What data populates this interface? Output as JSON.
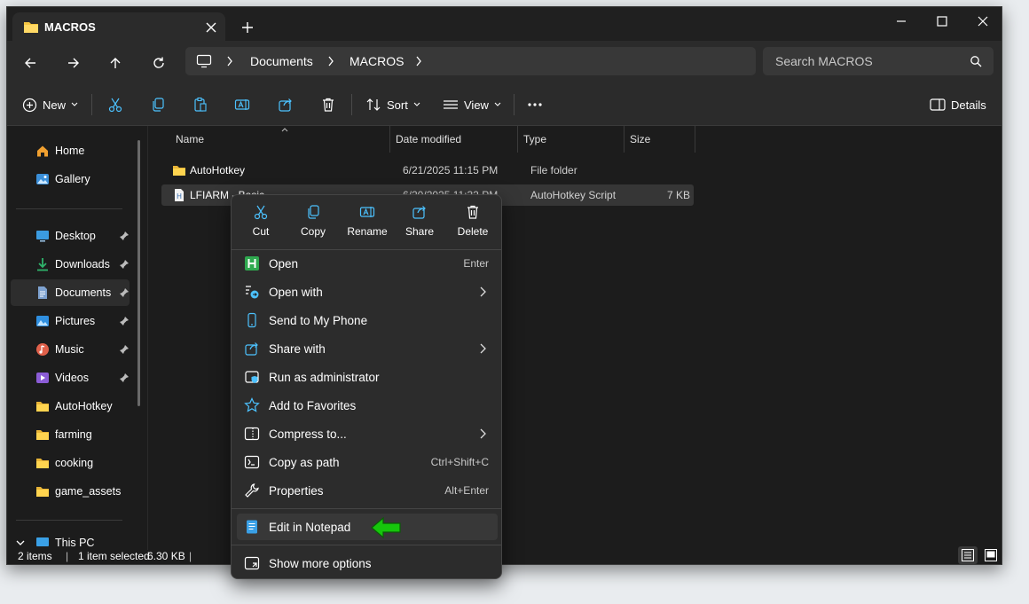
{
  "window": {
    "tab_title": "MACROS"
  },
  "nav": {
    "breadcrumbs": [
      "Documents",
      "MACROS"
    ],
    "search_placeholder": "Search MACROS"
  },
  "toolbar": {
    "new_label": "New",
    "sort_label": "Sort",
    "view_label": "View",
    "details_label": "Details"
  },
  "sidebar": {
    "top_items": [
      {
        "label": "Home",
        "icon": "home-icon"
      },
      {
        "label": "Gallery",
        "icon": "gallery-icon"
      }
    ],
    "pinned_items": [
      {
        "label": "Desktop",
        "icon": "desktop-icon"
      },
      {
        "label": "Downloads",
        "icon": "downloads-icon"
      },
      {
        "label": "Documents",
        "icon": "documents-icon"
      },
      {
        "label": "Pictures",
        "icon": "pictures-icon"
      },
      {
        "label": "Music",
        "icon": "music-icon"
      },
      {
        "label": "Videos",
        "icon": "videos-icon"
      },
      {
        "label": "AutoHotkey",
        "icon": "folder-icon"
      },
      {
        "label": "farming",
        "icon": "folder-icon"
      },
      {
        "label": "cooking",
        "icon": "folder-icon"
      },
      {
        "label": "game_assets",
        "icon": "folder-icon"
      }
    ],
    "this_pc_label": "This PC"
  },
  "file_list": {
    "columns": [
      "Name",
      "Date modified",
      "Type",
      "Size"
    ],
    "rows": [
      {
        "name": "AutoHotkey",
        "date": "6/21/2025 11:15 PM",
        "type": "File folder",
        "size": ""
      },
      {
        "name": "LFIARM - Basic",
        "date": "6/20/2025 11:32 PM",
        "type": "AutoHotkey Script",
        "size": "7 KB"
      }
    ]
  },
  "status": {
    "item_count": "2 items",
    "selection": "1 item selected",
    "size": "6.30 KB"
  },
  "context_menu": {
    "quick_actions": [
      "Cut",
      "Copy",
      "Rename",
      "Share",
      "Delete"
    ],
    "items": [
      {
        "label": "Open",
        "shortcut": "Enter",
        "icon": "autohotkey-icon"
      },
      {
        "label": "Open with",
        "shortcut": "",
        "icon": "open-with-icon"
      },
      {
        "label": "Send to My Phone",
        "shortcut": "",
        "icon": "phone-icon"
      },
      {
        "label": "Share with",
        "shortcut": "",
        "icon": "share-with-icon"
      },
      {
        "label": "Run as administrator",
        "shortcut": "",
        "icon": "shield-icon"
      },
      {
        "label": "Add to Favorites",
        "shortcut": "",
        "icon": "star-icon"
      },
      {
        "label": "Compress to...",
        "shortcut": "",
        "icon": "zip-icon"
      },
      {
        "label": "Copy as path",
        "shortcut": "Ctrl+Shift+C",
        "icon": "copy-path-icon"
      },
      {
        "label": "Properties",
        "shortcut": "Alt+Enter",
        "icon": "wrench-icon"
      },
      {
        "label": "Edit in Notepad",
        "shortcut": "",
        "icon": "notepad-icon"
      },
      {
        "label": "Show more options",
        "shortcut": "",
        "icon": "more-options-icon"
      }
    ]
  },
  "colors": {
    "folder": "#f4c542",
    "accent": "#4cc2ff",
    "arrow_green": "#16c60c"
  }
}
